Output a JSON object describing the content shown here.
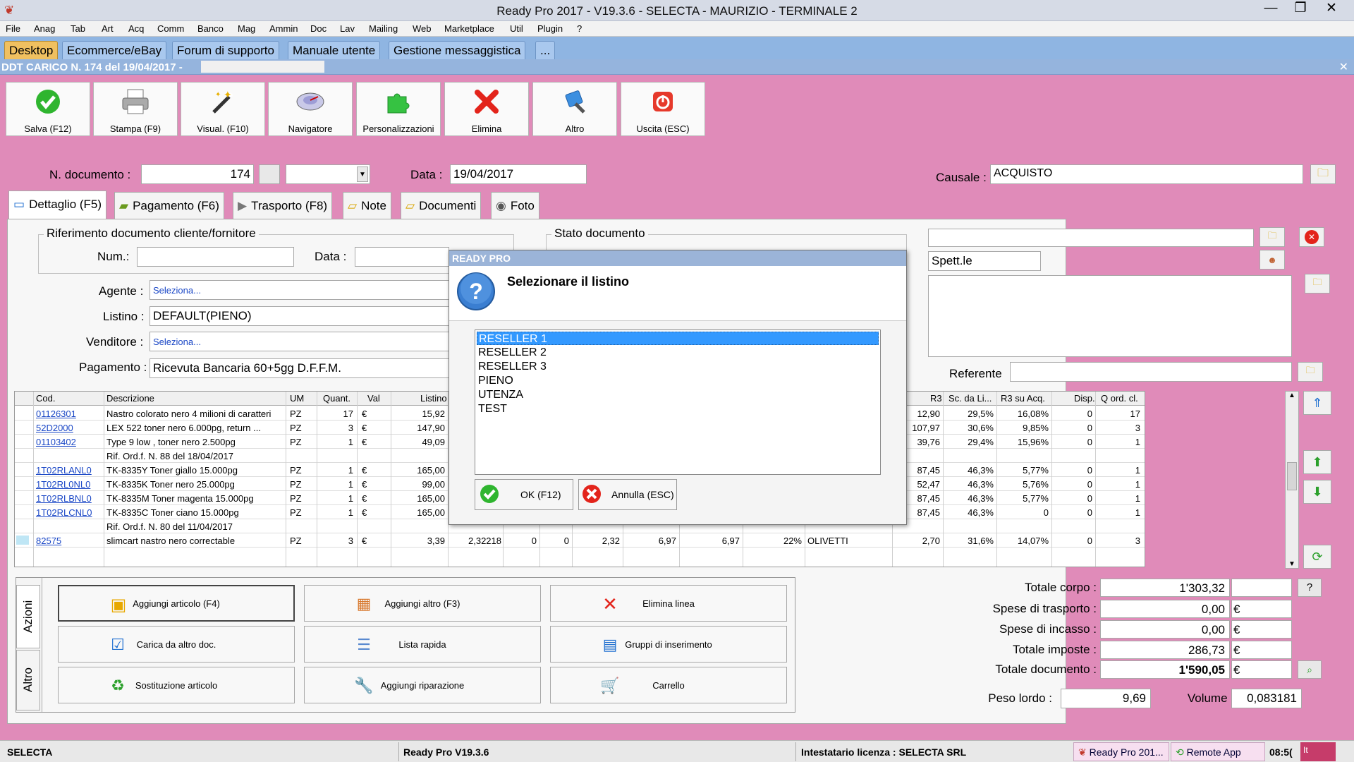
{
  "window": {
    "title": "Ready Pro 2017 - V19.3.6 - SELECTA - MAURIZIO - TERMINALE 2"
  },
  "menu": [
    "File",
    "Anag",
    "Tab",
    "Art",
    "Acq",
    "Comm",
    "Banco",
    "Mag",
    "Ammin",
    "Doc",
    "Lav",
    "Mailing",
    "Web",
    "Marketplace",
    "Util",
    "Plugin",
    "?"
  ],
  "tabs": [
    "Desktop",
    "Ecommerce/eBay",
    "Forum di supporto",
    "Manuale utente",
    "Gestione messaggistica",
    "..."
  ],
  "doc_title": "DDT CARICO N. 174 del 19/04/2017 -",
  "toolbar": [
    {
      "label": "Salva (F12)",
      "icon": "check-icon"
    },
    {
      "label": "Stampa (F9)",
      "icon": "printer-icon"
    },
    {
      "label": "Visual. (F10)",
      "icon": "magic-wand-icon"
    },
    {
      "label": "Navigatore",
      "icon": "navigator-icon"
    },
    {
      "label": "Personalizzazioni",
      "icon": "puzzle-icon"
    },
    {
      "label": "Elimina",
      "icon": "delete-x-icon"
    },
    {
      "label": "Altro",
      "icon": "tools-icon"
    },
    {
      "label": "Uscita (ESC)",
      "icon": "power-icon"
    }
  ],
  "header": {
    "ndoc_label": "N. documento :",
    "ndoc_value": "174",
    "data_label": "Data :",
    "data_value": "19/04/2017",
    "causale_label": "Causale :",
    "causale_value": "ACQUISTO"
  },
  "form_tabs": [
    {
      "label": "Dettaglio (F5)",
      "icon": "detail-icon"
    },
    {
      "label": "Pagamento (F6)",
      "icon": "money-icon"
    },
    {
      "label": "Trasporto (F8)",
      "icon": "truck-icon"
    },
    {
      "label": "Note",
      "icon": "note-icon"
    },
    {
      "label": "Documenti",
      "icon": "folder-icon"
    },
    {
      "label": "Foto",
      "icon": "camera-icon"
    }
  ],
  "ref": {
    "group": "Riferimento documento cliente/fornitore",
    "num_label": "Num.:",
    "data_label": "Data :"
  },
  "stato": {
    "group": "Stato documento"
  },
  "fields": {
    "agente_label": "Agente :",
    "agente_value": "Seleziona...",
    "listino_label": "Listino :",
    "listino_value": "DEFAULT(PIENO)",
    "venditore_label": "Venditore :",
    "venditore_value": "Seleziona...",
    "pagamento_label": "Pagamento :",
    "pagamento_value": "Ricevuta Bancaria 60+5gg D.F.F.M."
  },
  "address": {
    "spett": "Spett.le",
    "referente_label": "Referente"
  },
  "grid": {
    "headers_left": [
      "Cod.",
      "Descrizione",
      "UM",
      "Quant.",
      "Val",
      "Listino"
    ],
    "headers_right": [
      "R3",
      "Sc. da Li...",
      "R3 su Acq.",
      "Disp.",
      "Q ord. cl."
    ],
    "rows": [
      {
        "cod": "01126301",
        "desc": "Nastro colorato nero 4 milioni di caratteri",
        "um": "PZ",
        "q": "17",
        "val": "€",
        "list": "15,92",
        "r3": "12,90",
        "sc": "29,5%",
        "r3a": "16,08%",
        "disp": "0",
        "qo": "17"
      },
      {
        "cod": "52D2000",
        "desc": "LEX 522  toner nero 6.000pg, return ...",
        "um": "PZ",
        "q": "3",
        "val": "€",
        "list": "147,90",
        "r3": "107,97",
        "sc": "30,6%",
        "r3a": "9,85%",
        "disp": "0",
        "qo": "3"
      },
      {
        "cod": "01103402",
        "desc": "Type 9 low , toner nero 2.500pg",
        "um": "PZ",
        "q": "1",
        "val": "€",
        "list": "49,09",
        "r3": "39,76",
        "sc": "29,4%",
        "r3a": "15,96%",
        "disp": "0",
        "qo": "1"
      },
      {
        "cod": "",
        "desc": "Rif. Ord.f. N. 88 del 18/04/2017",
        "um": "",
        "q": "",
        "val": "",
        "list": "",
        "r3": "",
        "sc": "",
        "r3a": "",
        "disp": "",
        "qo": ""
      },
      {
        "cod": "1T02RLANL0",
        "desc": "TK-8335Y Toner giallo 15.000pg",
        "um": "PZ",
        "q": "1",
        "val": "€",
        "list": "165,00",
        "r3": "87,45",
        "sc": "46,3%",
        "r3a": "5,77%",
        "disp": "0",
        "qo": "1"
      },
      {
        "cod": "1T02RL0NL0",
        "desc": "TK-8335K Toner nero 25.000pg",
        "um": "PZ",
        "q": "1",
        "val": "€",
        "list": "99,00",
        "r3": "52,47",
        "sc": "46,3%",
        "r3a": "5,76%",
        "disp": "0",
        "qo": "1"
      },
      {
        "cod": "1T02RLBNL0",
        "desc": "TK-8335M Toner magenta 15.000pg",
        "um": "PZ",
        "q": "1",
        "val": "€",
        "list": "165,00",
        "r3": "87,45",
        "sc": "46,3%",
        "r3a": "5,77%",
        "disp": "0",
        "qo": "1"
      },
      {
        "cod": "1T02RLCNL0",
        "desc": "TK-8335C Toner ciano 15.000pg",
        "um": "PZ",
        "q": "1",
        "val": "€",
        "list": "165,00",
        "r3": "87,45",
        "sc": "46,3%",
        "r3a": "0",
        "disp": "0",
        "qo": "1"
      },
      {
        "cod": "",
        "desc": "Rif. Ord.f. N. 80 del 11/04/2017",
        "um": "",
        "q": "",
        "val": "",
        "list": "",
        "r3": "",
        "sc": "",
        "r3a": "",
        "disp": "",
        "qo": ""
      },
      {
        "cod": "82575",
        "desc": "slimcart nastro nero correctable",
        "um": "PZ",
        "q": "3",
        "val": "€",
        "list": "3,39",
        "r3": "2,70",
        "sc": "31,6%",
        "r3a": "14,07%",
        "disp": "0",
        "qo": "3"
      }
    ],
    "row10_mid": [
      "2,32218",
      "0",
      "0",
      "2,32",
      "6,97",
      "6,97",
      "22%",
      "OLIVETTI"
    ]
  },
  "actions_tabs": [
    "Azioni",
    "Altro"
  ],
  "actions": [
    {
      "label": "Aggiungi articolo (F4)",
      "icon": "add-article-icon"
    },
    {
      "label": "Aggiungi altro (F3)",
      "icon": "add-other-icon"
    },
    {
      "label": "Elimina linea",
      "icon": "delete-line-icon"
    },
    {
      "label": "Carica da altro doc.",
      "icon": "load-doc-icon"
    },
    {
      "label": "Lista rapida",
      "icon": "quick-list-icon"
    },
    {
      "label": "Gruppi di inserimento",
      "icon": "insert-group-icon"
    },
    {
      "label": "Sostituzione articolo",
      "icon": "replace-article-icon"
    },
    {
      "label": "Aggiungi riparazione",
      "icon": "wrench-icon"
    },
    {
      "label": "Carrello",
      "icon": "cart-icon"
    }
  ],
  "totals": [
    {
      "label": "Totale corpo :",
      "value": "1'303,32",
      "cur": ""
    },
    {
      "label": "Spese di trasporto :",
      "value": "0,00",
      "cur": "€"
    },
    {
      "label": "Spese di incasso :",
      "value": "0,00",
      "cur": "€"
    },
    {
      "label": "Totale imposte :",
      "value": "286,73",
      "cur": "€"
    },
    {
      "label": "Totale documento :",
      "value": "1'590,05",
      "cur": "€"
    }
  ],
  "peso": {
    "label": "Peso lordo :",
    "value": "9,69"
  },
  "volume": {
    "label": "Volume :",
    "value": "0,083181"
  },
  "help": "?",
  "status": {
    "company": "SELECTA",
    "version": "Ready Pro V19.3.6",
    "license": "Intestatario licenza : SELECTA SRL",
    "task1": "Ready Pro 201...",
    "task2": "Remote App",
    "clock": "08:5(",
    "lang": "It"
  },
  "dialog": {
    "title": "READY PRO",
    "message": "Selezionare il listino",
    "items": [
      "RESELLER 1",
      "RESELLER 2",
      "RESELLER 3",
      "PIENO",
      "UTENZA",
      "TEST"
    ],
    "selected": 0,
    "ok": "OK (F12)",
    "cancel": "Annulla (ESC)"
  }
}
